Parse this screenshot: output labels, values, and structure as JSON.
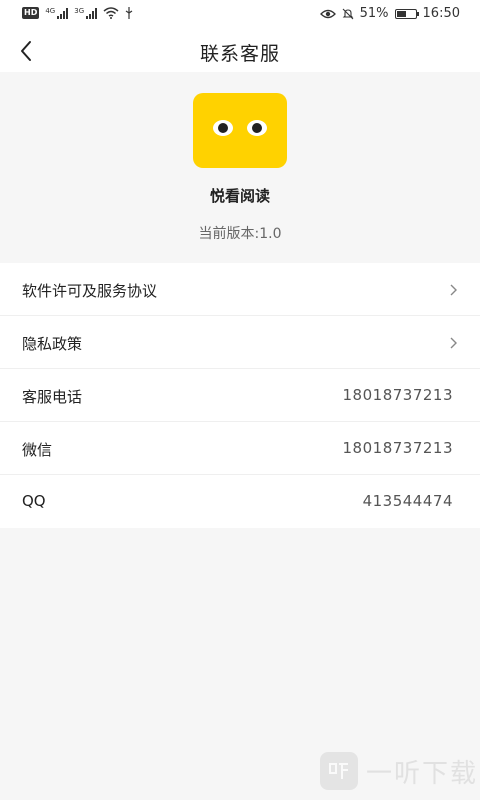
{
  "status_bar": {
    "hd": "HD",
    "net1": "4G",
    "net2": "3G",
    "battery_pct_text": "51%",
    "battery_level": 0.51,
    "time": "16:50"
  },
  "nav": {
    "title": "联系客服"
  },
  "app": {
    "name": "悦看阅读",
    "version": "当前版本:1.0",
    "icon_color": "#ffd200"
  },
  "list": [
    {
      "label": "软件许可及服务协议",
      "value": "",
      "chevron": true
    },
    {
      "label": "隐私政策",
      "value": "",
      "chevron": true
    },
    {
      "label": "客服电话",
      "value": "18018737213",
      "chevron": false
    },
    {
      "label": "微信",
      "value": "18018737213",
      "chevron": false
    },
    {
      "label": "QQ",
      "value": "413544474",
      "chevron": false
    }
  ],
  "watermark": {
    "text": "一听下载"
  }
}
